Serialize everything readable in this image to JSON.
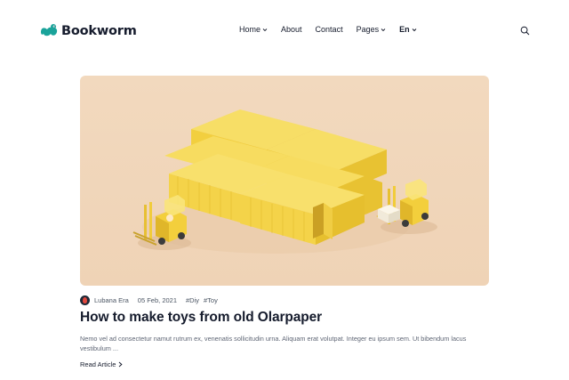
{
  "brand": {
    "name": "Bookworm",
    "accent": "#1aa39a"
  },
  "nav": {
    "items": [
      {
        "label": "Home",
        "has_dropdown": true
      },
      {
        "label": "About",
        "has_dropdown": false
      },
      {
        "label": "Contact",
        "has_dropdown": false
      },
      {
        "label": "Pages",
        "has_dropdown": true
      },
      {
        "label": "En",
        "has_dropdown": true
      }
    ],
    "search_icon": "search-icon"
  },
  "post": {
    "image_description_icon": "shipping-containers-forklifts-illustration",
    "author": "Lubana Era",
    "date": "05 Feb, 2021",
    "tags": [
      "#Diy",
      "#Toy"
    ],
    "title": "How to make toys from old Olarpaper",
    "excerpt": "Nemo vel ad consectetur namut rutrum ex, venenatis sollicitudin urna. Aliquam erat volutpat. Integer eu ipsum sem. Ut bibendum lacus vestibulum ...",
    "read_more": "Read Article"
  },
  "colors": {
    "text": "#161c2d",
    "muted": "#5f6675",
    "hero_bg": "#f2d9be",
    "container_yellow": "#f5d64a"
  }
}
